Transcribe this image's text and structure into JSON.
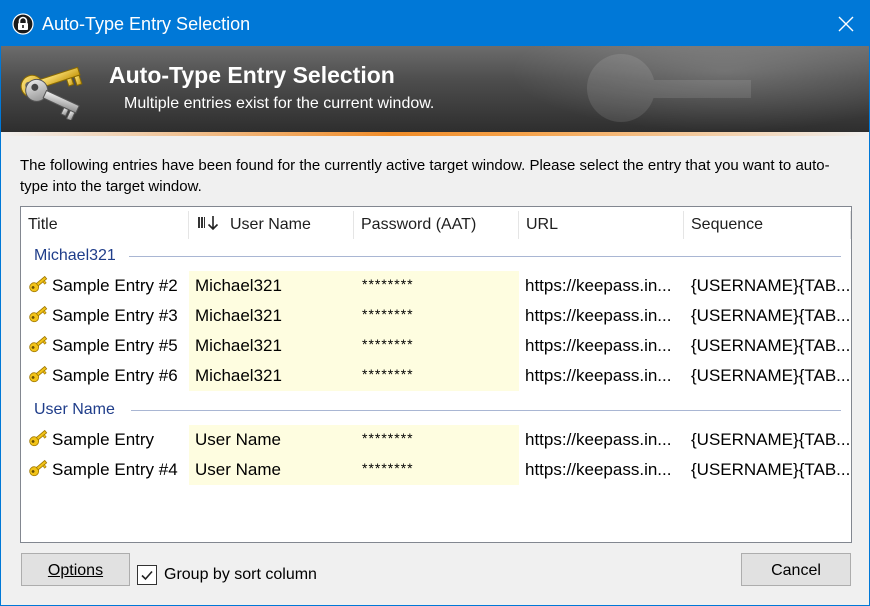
{
  "window": {
    "title": "Auto-Type Entry Selection",
    "accent_color": "#0078d7"
  },
  "banner": {
    "title": "Auto-Type Entry Selection",
    "subtitle": "Multiple entries exist for the current window.",
    "icon": "keys-icon"
  },
  "description": "The following entries have been found for the currently active target window. Please select the entry that you want to auto-type into the target window.",
  "list": {
    "columns": [
      "Title",
      "User Name",
      "Password (AAT)",
      "URL",
      "Sequence"
    ],
    "sorted_column": "User Name",
    "groups": [
      {
        "name": "Michael321",
        "rows": [
          {
            "title": "Sample Entry #2",
            "user": "Michael321",
            "password": "********",
            "url": "https://keepass.in...",
            "sequence": "{USERNAME}{TAB..."
          },
          {
            "title": "Sample Entry #3",
            "user": "Michael321",
            "password": "********",
            "url": "https://keepass.in...",
            "sequence": "{USERNAME}{TAB..."
          },
          {
            "title": "Sample Entry #5",
            "user": "Michael321",
            "password": "********",
            "url": "https://keepass.in...",
            "sequence": "{USERNAME}{TAB..."
          },
          {
            "title": "Sample Entry #6",
            "user": "Michael321",
            "password": "********",
            "url": "https://keepass.in...",
            "sequence": "{USERNAME}{TAB..."
          }
        ]
      },
      {
        "name": "User Name",
        "rows": [
          {
            "title": "Sample Entry",
            "user": "User Name",
            "password": "********",
            "url": "https://keepass.in...",
            "sequence": "{USERNAME}{TAB..."
          },
          {
            "title": "Sample Entry #4",
            "user": "User Name",
            "password": "********",
            "url": "https://keepass.in...",
            "sequence": "{USERNAME}{TAB..."
          }
        ]
      }
    ]
  },
  "footer": {
    "options_label": "Options",
    "group_checkbox_label": "Group by sort column",
    "group_checked": true,
    "cancel_label": "Cancel"
  }
}
